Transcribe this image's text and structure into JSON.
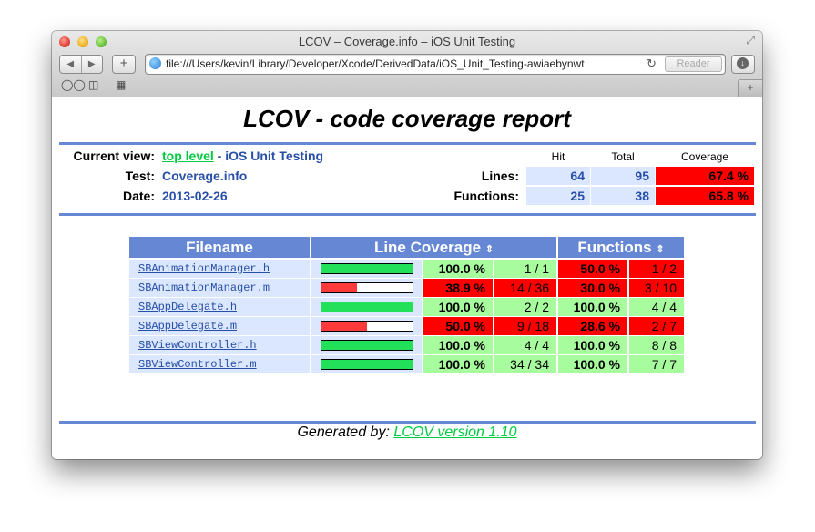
{
  "window": {
    "title": "LCOV – Coverage.info – iOS Unit Testing",
    "url": "file:///Users/kevin/Library/Developer/Xcode/DerivedData/iOS_Unit_Testing-awiaebynwt",
    "reader_label": "Reader",
    "nav_back": "◀",
    "nav_forward": "▶",
    "plus": "+",
    "new_tab": "+"
  },
  "report": {
    "title": "LCOV - code coverage report",
    "current_view_label": "Current view:",
    "current_view_link": "top level",
    "current_view_rest": " - iOS Unit Testing",
    "test_label": "Test:",
    "test_value": "Coverage.info",
    "date_label": "Date:",
    "date_value": "2013-02-26",
    "summary": {
      "headers": [
        "Hit",
        "Total",
        "Coverage"
      ],
      "lines": {
        "label": "Lines:",
        "hit": "64",
        "total": "95",
        "coverage": "67.4 %"
      },
      "functions": {
        "label": "Functions:",
        "hit": "25",
        "total": "38",
        "coverage": "65.8 %"
      }
    }
  },
  "table": {
    "headers": {
      "filename": "Filename",
      "line_coverage": "Line Coverage",
      "functions": "Functions",
      "sort_icon": "⇕"
    },
    "rows": [
      {
        "file": "SBAnimationManager.h",
        "bar": 100,
        "line_pct": "100.0 %",
        "line_cnt": "1 / 1",
        "line_status": "hi",
        "func_pct": "50.0 %",
        "func_cnt": "1 / 2",
        "func_status": "lo"
      },
      {
        "file": "SBAnimationManager.m",
        "bar": 38.9,
        "line_pct": "38.9 %",
        "line_cnt": "14 / 36",
        "line_status": "lo",
        "func_pct": "30.0 %",
        "func_cnt": "3 / 10",
        "func_status": "lo"
      },
      {
        "file": "SBAppDelegate.h",
        "bar": 100,
        "line_pct": "100.0 %",
        "line_cnt": "2 / 2",
        "line_status": "hi",
        "func_pct": "100.0 %",
        "func_cnt": "4 / 4",
        "func_status": "hi"
      },
      {
        "file": "SBAppDelegate.m",
        "bar": 50,
        "line_pct": "50.0 %",
        "line_cnt": "9 / 18",
        "line_status": "lo",
        "func_pct": "28.6 %",
        "func_cnt": "2 / 7",
        "func_status": "lo"
      },
      {
        "file": "SBViewController.h",
        "bar": 100,
        "line_pct": "100.0 %",
        "line_cnt": "4 / 4",
        "line_status": "hi",
        "func_pct": "100.0 %",
        "func_cnt": "8 / 8",
        "func_status": "hi"
      },
      {
        "file": "SBViewController.m",
        "bar": 100,
        "line_pct": "100.0 %",
        "line_cnt": "34 / 34",
        "line_status": "hi",
        "func_pct": "100.0 %",
        "func_cnt": "7 / 7",
        "func_status": "hi"
      }
    ]
  },
  "footer": {
    "prefix": "Generated by: ",
    "link": "LCOV version 1.10"
  },
  "colors": {
    "accent": "#6688d4",
    "value_text": "#284fa8",
    "cell_bg": "#dae7fe",
    "hi_bg": "#a7fc9d",
    "lo_bg": "#ff0000",
    "bar_green": "#22e05a",
    "bar_red": "#ff3a3a",
    "link_green": "#00cb40"
  }
}
